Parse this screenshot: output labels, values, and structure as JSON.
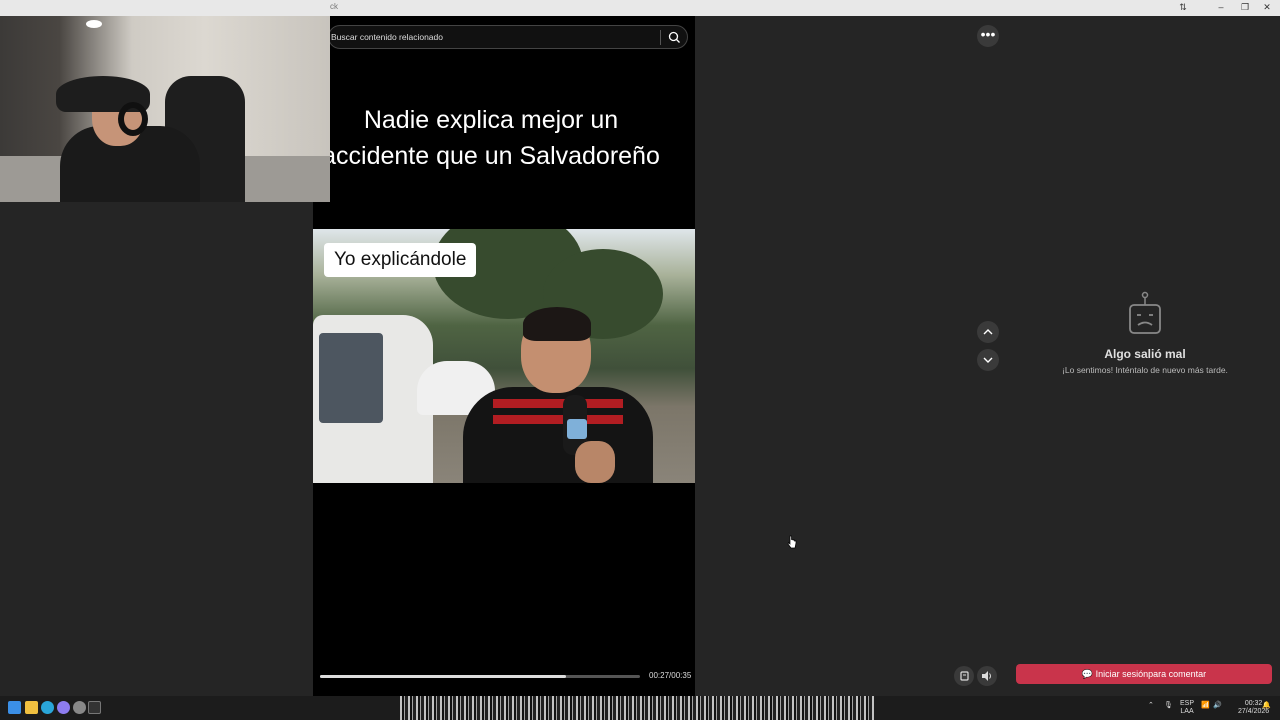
{
  "window": {
    "title": "ck",
    "controls": [
      "⇅",
      "–",
      "❐",
      "✕"
    ]
  },
  "search": {
    "placeholder": "Buscar contenido relacionado",
    "icon": "search-icon"
  },
  "video": {
    "headline": "Nadie explica mejor un accidente que un Salvadoreño",
    "caption": "Yo explicándole",
    "time": "00:27/00:35",
    "progress": 0.77
  },
  "actions": {
    "more_label": "•••"
  },
  "error": {
    "title": "Algo salió mal",
    "message": "¡Lo sentimos! Inténtalo de nuevo más tarde.",
    "icon": "sad-robot-icon"
  },
  "login_button": "Iniciar sesiónpara comentar",
  "colors": {
    "accent": "#c9344b",
    "background": "#252525",
    "video_bg": "#000000"
  },
  "taskbar": {
    "lang_top": "ESP",
    "lang_bottom": "LAA",
    "time": "00:32",
    "date": "27/4/2026"
  }
}
